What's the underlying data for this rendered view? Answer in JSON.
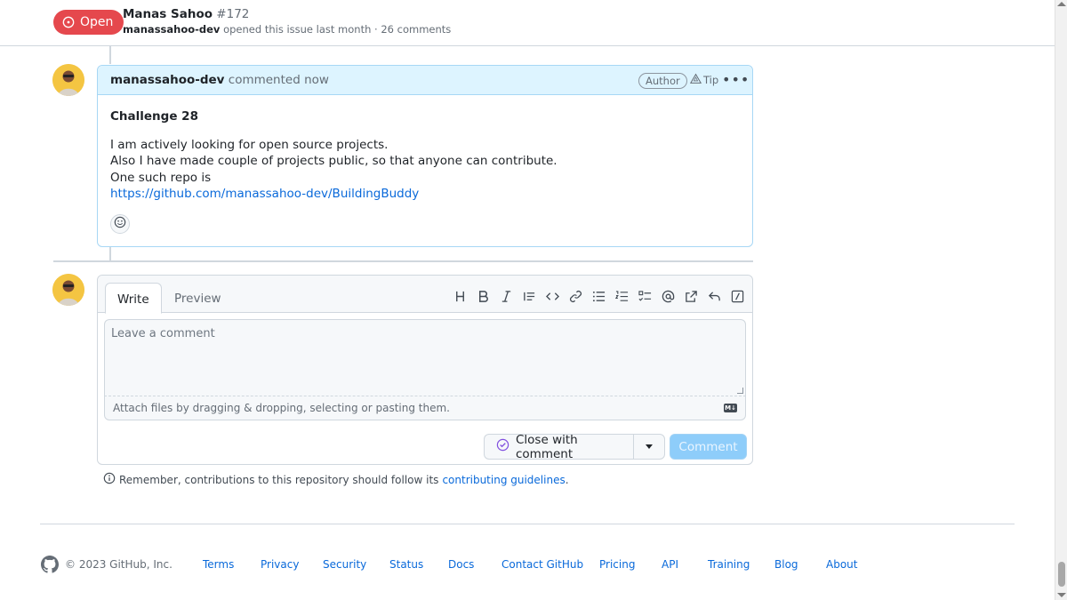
{
  "header": {
    "state_label": "Open",
    "title": "Manas Sahoo",
    "number": "#172",
    "author": "manassahoo-dev",
    "meta": "opened this issue last month · 26 comments"
  },
  "comment": {
    "author": "manassahoo-dev",
    "action": "commented now",
    "author_badge": "Author",
    "tip_label": "Tip",
    "heading": "Challenge 28",
    "line1": "I am actively looking for open source projects.",
    "line2": "Also I have made couple of projects public, so that anyone can contribute.",
    "line3": "One such repo is",
    "link": "https://github.com/manassahoo-dev/BuildingBuddy"
  },
  "editor": {
    "tab_write": "Write",
    "tab_preview": "Preview",
    "placeholder": "Leave a comment",
    "attach_hint": "Attach files by dragging & dropping, selecting or pasting them.",
    "close_label": "Close with comment",
    "comment_label": "Comment",
    "toolbar_icons": [
      "heading-icon",
      "bold-icon",
      "italic-icon",
      "quote-icon",
      "code-icon",
      "link-icon",
      "unordered-list-icon",
      "ordered-list-icon",
      "task-list-icon",
      "mention-icon",
      "cross-reference-icon",
      "reply-icon",
      "slash-command-icon"
    ]
  },
  "reminder": {
    "text": "Remember, contributions to this repository should follow its",
    "link": "contributing guidelines",
    "end": "."
  },
  "footer": {
    "copyright": "© 2023 GitHub, Inc.",
    "links": [
      "Terms",
      "Privacy",
      "Security",
      "Status",
      "Docs",
      "Contact GitHub",
      "Pricing",
      "API",
      "Training",
      "Blog",
      "About"
    ]
  },
  "colors": {
    "open_badge": "#e5484d",
    "comment_header": "#ddf4ff",
    "link": "#0969da"
  }
}
